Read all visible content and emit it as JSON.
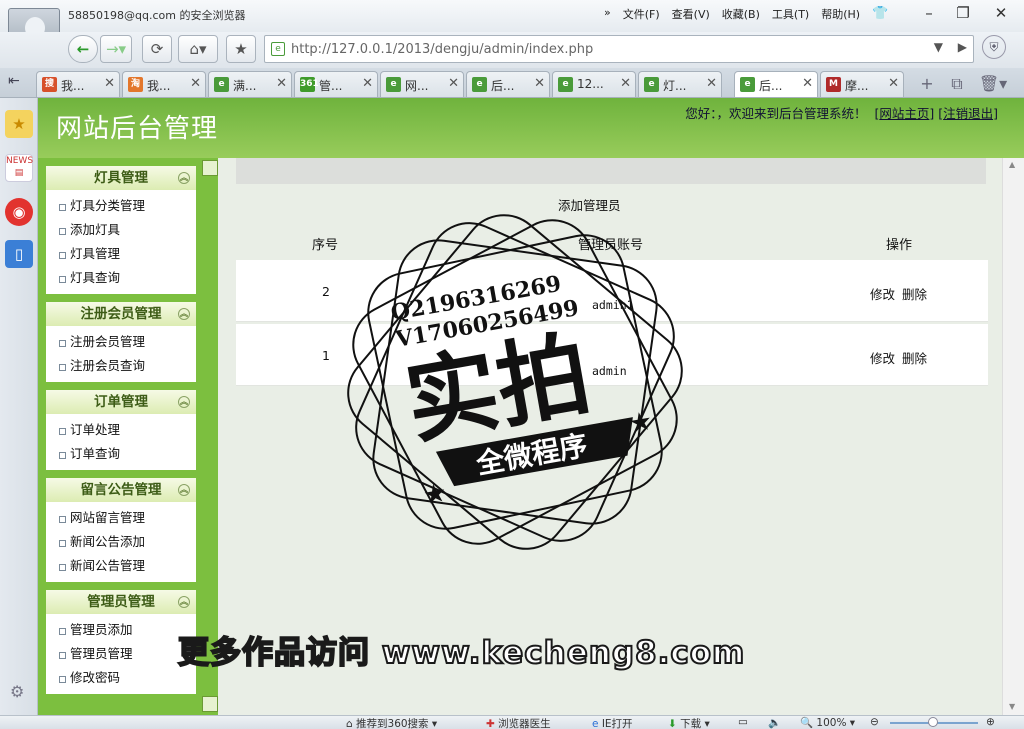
{
  "browser": {
    "user": "58850198@qq.com 的安全浏览器",
    "menu": [
      "文件(F)",
      "查看(V)",
      "收藏(B)",
      "工具(T)",
      "帮助(H)"
    ],
    "url": "http://127.0.0.1/2013/dengju/admin/index.php",
    "tabs": [
      {
        "label": "我...",
        "icon": "sou-icon",
        "color": "#d7502a",
        "glyph": "搜"
      },
      {
        "label": "我...",
        "icon": "taobao-icon",
        "color": "#e3772c",
        "glyph": "淘"
      },
      {
        "label": "满...",
        "icon": "page-icon",
        "color": "#4a9b3a",
        "glyph": "e"
      },
      {
        "label": "管...",
        "icon": "360-icon",
        "color": "#3f9b2a",
        "glyph": "361"
      },
      {
        "label": "网...",
        "icon": "page-icon",
        "color": "#4a9b3a",
        "glyph": "e"
      },
      {
        "label": "后...",
        "icon": "page-icon",
        "color": "#4a9b3a",
        "glyph": "e"
      },
      {
        "label": "12...",
        "icon": "page-icon",
        "color": "#4a9b3a",
        "glyph": "e"
      },
      {
        "label": "灯...",
        "icon": "page-icon",
        "color": "#4a9b3a",
        "glyph": "e"
      },
      {
        "label": "后...",
        "icon": "page-icon",
        "color": "#4a9b3a",
        "glyph": "e",
        "active": true
      },
      {
        "label": "摩...",
        "icon": "m-icon",
        "color": "#b02a2a",
        "glyph": "M"
      }
    ],
    "status": {
      "recommend": "推荐到360搜索",
      "doctor": "浏览器医生",
      "ie": "IE打开",
      "download": "下载",
      "zoom": "100%"
    }
  },
  "header": {
    "title": "网站后台管理",
    "greeting": "您好：，欢迎来到后台管理系统！",
    "home_link": "网站主页",
    "logout_link": "注销退出"
  },
  "sidebar": {
    "groups": [
      {
        "title": "灯具管理",
        "items": [
          "灯具分类管理",
          "添加灯具",
          "灯具管理",
          "灯具查询"
        ]
      },
      {
        "title": "注册会员管理",
        "items": [
          "注册会员管理",
          "注册会员查询"
        ]
      },
      {
        "title": "订单管理",
        "items": [
          "订单处理",
          "订单查询"
        ]
      },
      {
        "title": "留言公告管理",
        "items": [
          "网站留言管理",
          "新闻公告添加",
          "新闻公告管理"
        ]
      },
      {
        "title": "管理员管理",
        "items": [
          "管理员添加",
          "管理员管理",
          "修改密码"
        ]
      }
    ]
  },
  "table": {
    "caption": "添加管理员",
    "headers": [
      "序号",
      "管理员账号",
      "操作"
    ],
    "rows": [
      {
        "index": "2",
        "account": "admin1",
        "edit": "修改",
        "delete": "删除"
      },
      {
        "index": "1",
        "account": "admin",
        "edit": "修改",
        "delete": "删除"
      }
    ]
  },
  "watermark": {
    "qq": "Q2196316269",
    "v": "V17060256499",
    "big": "实拍",
    "banner": "全微程序",
    "promo": "更多作品访问 www.kecheng8.com"
  }
}
